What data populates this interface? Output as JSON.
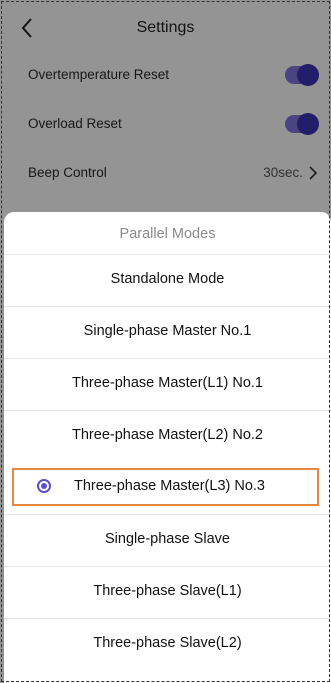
{
  "header": {
    "title": "Settings",
    "back_icon": "chevron-left-icon"
  },
  "settings": {
    "overtemperature_reset": {
      "label": "Overtemperature Reset",
      "on": true
    },
    "overload_reset": {
      "label": "Overload Reset",
      "on": true
    },
    "beep_control": {
      "label": "Beep Control",
      "value": "30sec.",
      "icon": "chevron-right-icon"
    }
  },
  "sheet": {
    "title": "Parallel Modes",
    "options": [
      {
        "label": "Standalone Mode"
      },
      {
        "label": "Single-phase Master No.1"
      },
      {
        "label": "Three-phase Master(L1) No.1"
      },
      {
        "label": "Three-phase Master(L2) No.2"
      },
      {
        "label": "Three-phase Master(L3) No.3",
        "selected": true
      },
      {
        "label": "Single-phase Slave"
      },
      {
        "label": "Three-phase Slave(L1)"
      },
      {
        "label": "Three-phase Slave(L2)"
      }
    ]
  },
  "colors": {
    "accent": "#5a51c9",
    "toggle_track": "#7d77e0",
    "highlight": "#e8853e"
  }
}
